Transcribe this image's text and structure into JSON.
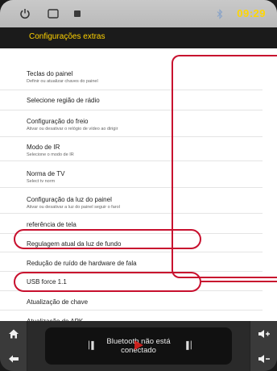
{
  "status_bar": {
    "time": "09:29",
    "icons": [
      "power-icon",
      "window-icon",
      "square-icon",
      "bluetooth-icon"
    ]
  },
  "header": {
    "title": "Configurações extras"
  },
  "settings": {
    "items": [
      {
        "title": "Teclas do painel",
        "subtitle": "Definir ou atualizar chaves do painel"
      },
      {
        "title": "Selecione região de rádio",
        "subtitle": ""
      },
      {
        "title": "Configuração do freio",
        "subtitle": "Ativar ou desativar o relógio de vídeo ao dirigir"
      },
      {
        "title": "Modo de IR",
        "subtitle": "Selecione o modo de IR"
      },
      {
        "title": "Norma de TV",
        "subtitle": "Select tv norm"
      },
      {
        "title": "Configuração da luz do painel",
        "subtitle": "Ativar ou desativar a luz do painel seguir o farol"
      },
      {
        "title": "referência de tela",
        "subtitle": ""
      },
      {
        "title": "Regulagem atual da luz de fundo",
        "subtitle": ""
      },
      {
        "title": "Redução de ruído de hardware de fala",
        "subtitle": ""
      },
      {
        "title": "USB force 1.1",
        "subtitle": ""
      },
      {
        "title": "Atualização de chave",
        "subtitle": ""
      },
      {
        "title": "Atualização de APK",
        "subtitle": ""
      }
    ]
  },
  "bottom_bar": {
    "bt_status_line1": "Bluetooth não está",
    "bt_status_line2": "conectado",
    "left_buttons": [
      "home-icon",
      "back-icon"
    ],
    "right_buttons": [
      "volume-up-icon",
      "volume-down-icon"
    ],
    "accent": "#e8231f"
  },
  "colors": {
    "highlight": "#c8102e",
    "title_yellow": "#ffd200",
    "time_yellow": "#ffd700"
  }
}
